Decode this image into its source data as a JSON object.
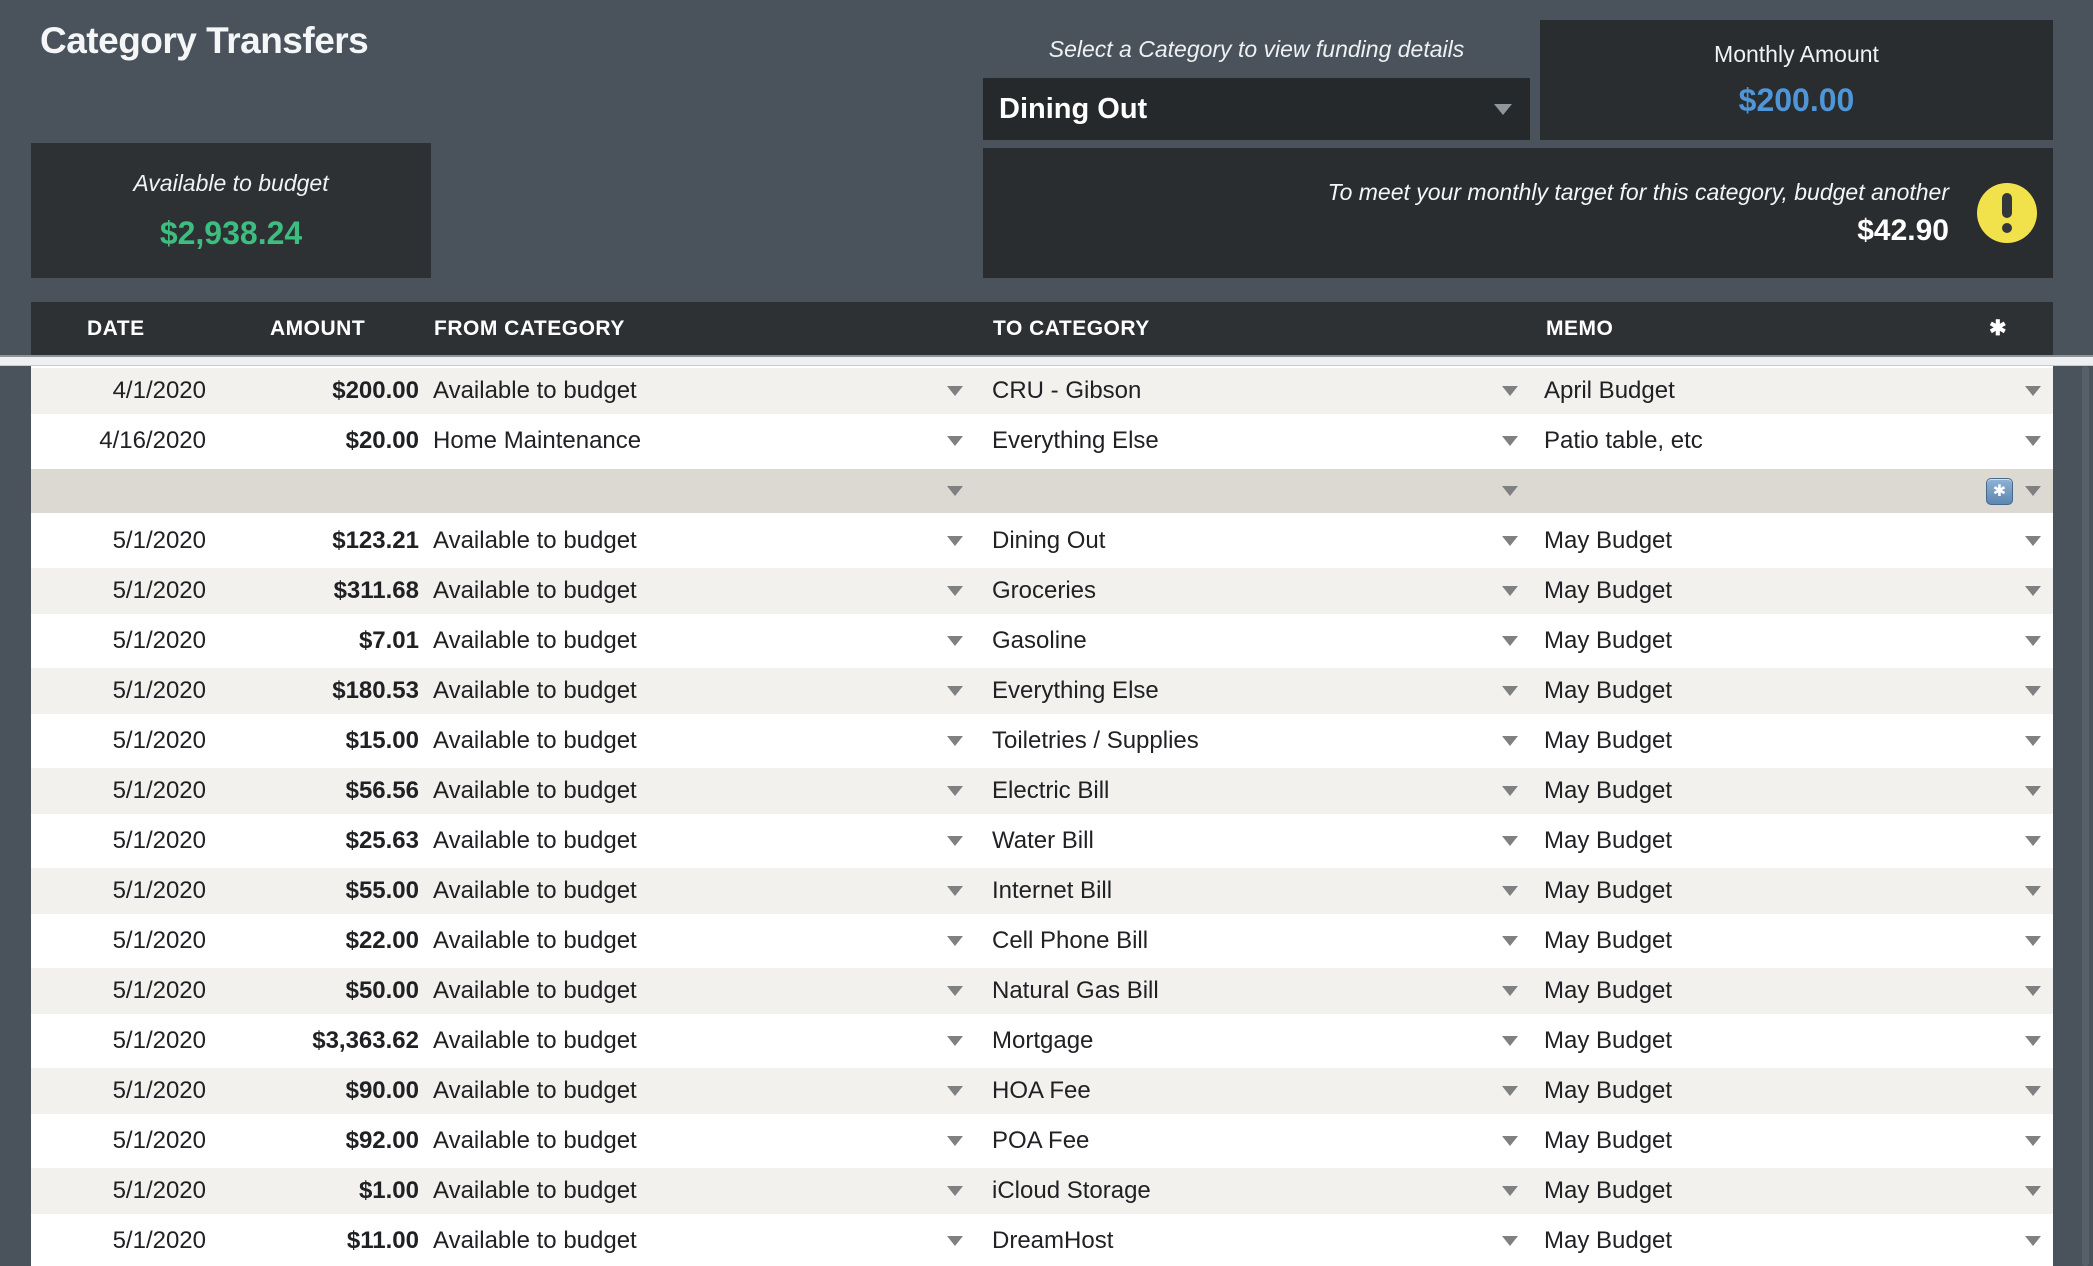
{
  "page": {
    "title": "Category Transfers"
  },
  "funding_panel": {
    "select_label": "Select a Category to view funding details",
    "selected_category": "Dining Out",
    "monthly_amount_label": "Monthly Amount",
    "monthly_amount": "$200.00",
    "target_message": "To meet your monthly target for this category, budget another",
    "target_amount": "$42.90"
  },
  "available_panel": {
    "label": "Available to budget",
    "amount": "$2,938.24"
  },
  "icons": {
    "header_asterisk": "✱",
    "new_row_button_asterisk": "✱"
  },
  "colors": {
    "background": "#4a535c",
    "panel_dark": "#292d30",
    "available_green": "#3dbd80",
    "monthly_blue": "#4f96d8",
    "alert_yellow": "#f1e24c",
    "row_shade": "#f2f1ee",
    "new_row_beige": "#dcd9d2"
  },
  "table": {
    "headers": {
      "date": "DATE",
      "amount": "AMOUNT",
      "from": "FROM CATEGORY",
      "to": "TO CATEGORY",
      "memo": "MEMO"
    },
    "rows": [
      {
        "type": "entry",
        "date": "4/1/2020",
        "amount": "$200.00",
        "from": "Available to budget",
        "to": "CRU - Gibson",
        "memo": "April Budget"
      },
      {
        "type": "entry",
        "date": "4/16/2020",
        "amount": "$20.00",
        "from": "Home Maintenance",
        "to": "Everything Else",
        "memo": "Patio table, etc"
      },
      {
        "type": "new",
        "date": "",
        "amount": "",
        "from": "",
        "to": "",
        "memo": ""
      },
      {
        "type": "entry",
        "date": "5/1/2020",
        "amount": "$123.21",
        "from": "Available to budget",
        "to": "Dining Out",
        "memo": "May Budget"
      },
      {
        "type": "entry",
        "date": "5/1/2020",
        "amount": "$311.68",
        "from": "Available to budget",
        "to": "Groceries",
        "memo": "May Budget"
      },
      {
        "type": "entry",
        "date": "5/1/2020",
        "amount": "$7.01",
        "from": "Available to budget",
        "to": "Gasoline",
        "memo": "May Budget"
      },
      {
        "type": "entry",
        "date": "5/1/2020",
        "amount": "$180.53",
        "from": "Available to budget",
        "to": "Everything Else",
        "memo": "May Budget"
      },
      {
        "type": "entry",
        "date": "5/1/2020",
        "amount": "$15.00",
        "from": "Available to budget",
        "to": "Toiletries / Supplies",
        "memo": "May Budget"
      },
      {
        "type": "entry",
        "date": "5/1/2020",
        "amount": "$56.56",
        "from": "Available to budget",
        "to": "Electric Bill",
        "memo": "May Budget"
      },
      {
        "type": "entry",
        "date": "5/1/2020",
        "amount": "$25.63",
        "from": "Available to budget",
        "to": "Water Bill",
        "memo": "May Budget"
      },
      {
        "type": "entry",
        "date": "5/1/2020",
        "amount": "$55.00",
        "from": "Available to budget",
        "to": "Internet Bill",
        "memo": "May Budget"
      },
      {
        "type": "entry",
        "date": "5/1/2020",
        "amount": "$22.00",
        "from": "Available to budget",
        "to": "Cell Phone Bill",
        "memo": "May Budget"
      },
      {
        "type": "entry",
        "date": "5/1/2020",
        "amount": "$50.00",
        "from": "Available to budget",
        "to": "Natural Gas Bill",
        "memo": "May Budget"
      },
      {
        "type": "entry",
        "date": "5/1/2020",
        "amount": "$3,363.62",
        "from": "Available to budget",
        "to": "Mortgage",
        "memo": "May Budget"
      },
      {
        "type": "entry",
        "date": "5/1/2020",
        "amount": "$90.00",
        "from": "Available to budget",
        "to": "HOA Fee",
        "memo": "May Budget"
      },
      {
        "type": "entry",
        "date": "5/1/2020",
        "amount": "$92.00",
        "from": "Available to budget",
        "to": "POA Fee",
        "memo": "May Budget"
      },
      {
        "type": "entry",
        "date": "5/1/2020",
        "amount": "$1.00",
        "from": "Available to budget",
        "to": "iCloud Storage",
        "memo": "May Budget"
      },
      {
        "type": "entry",
        "date": "5/1/2020",
        "amount": "$11.00",
        "from": "Available to budget",
        "to": "DreamHost",
        "memo": "May Budget"
      }
    ]
  }
}
